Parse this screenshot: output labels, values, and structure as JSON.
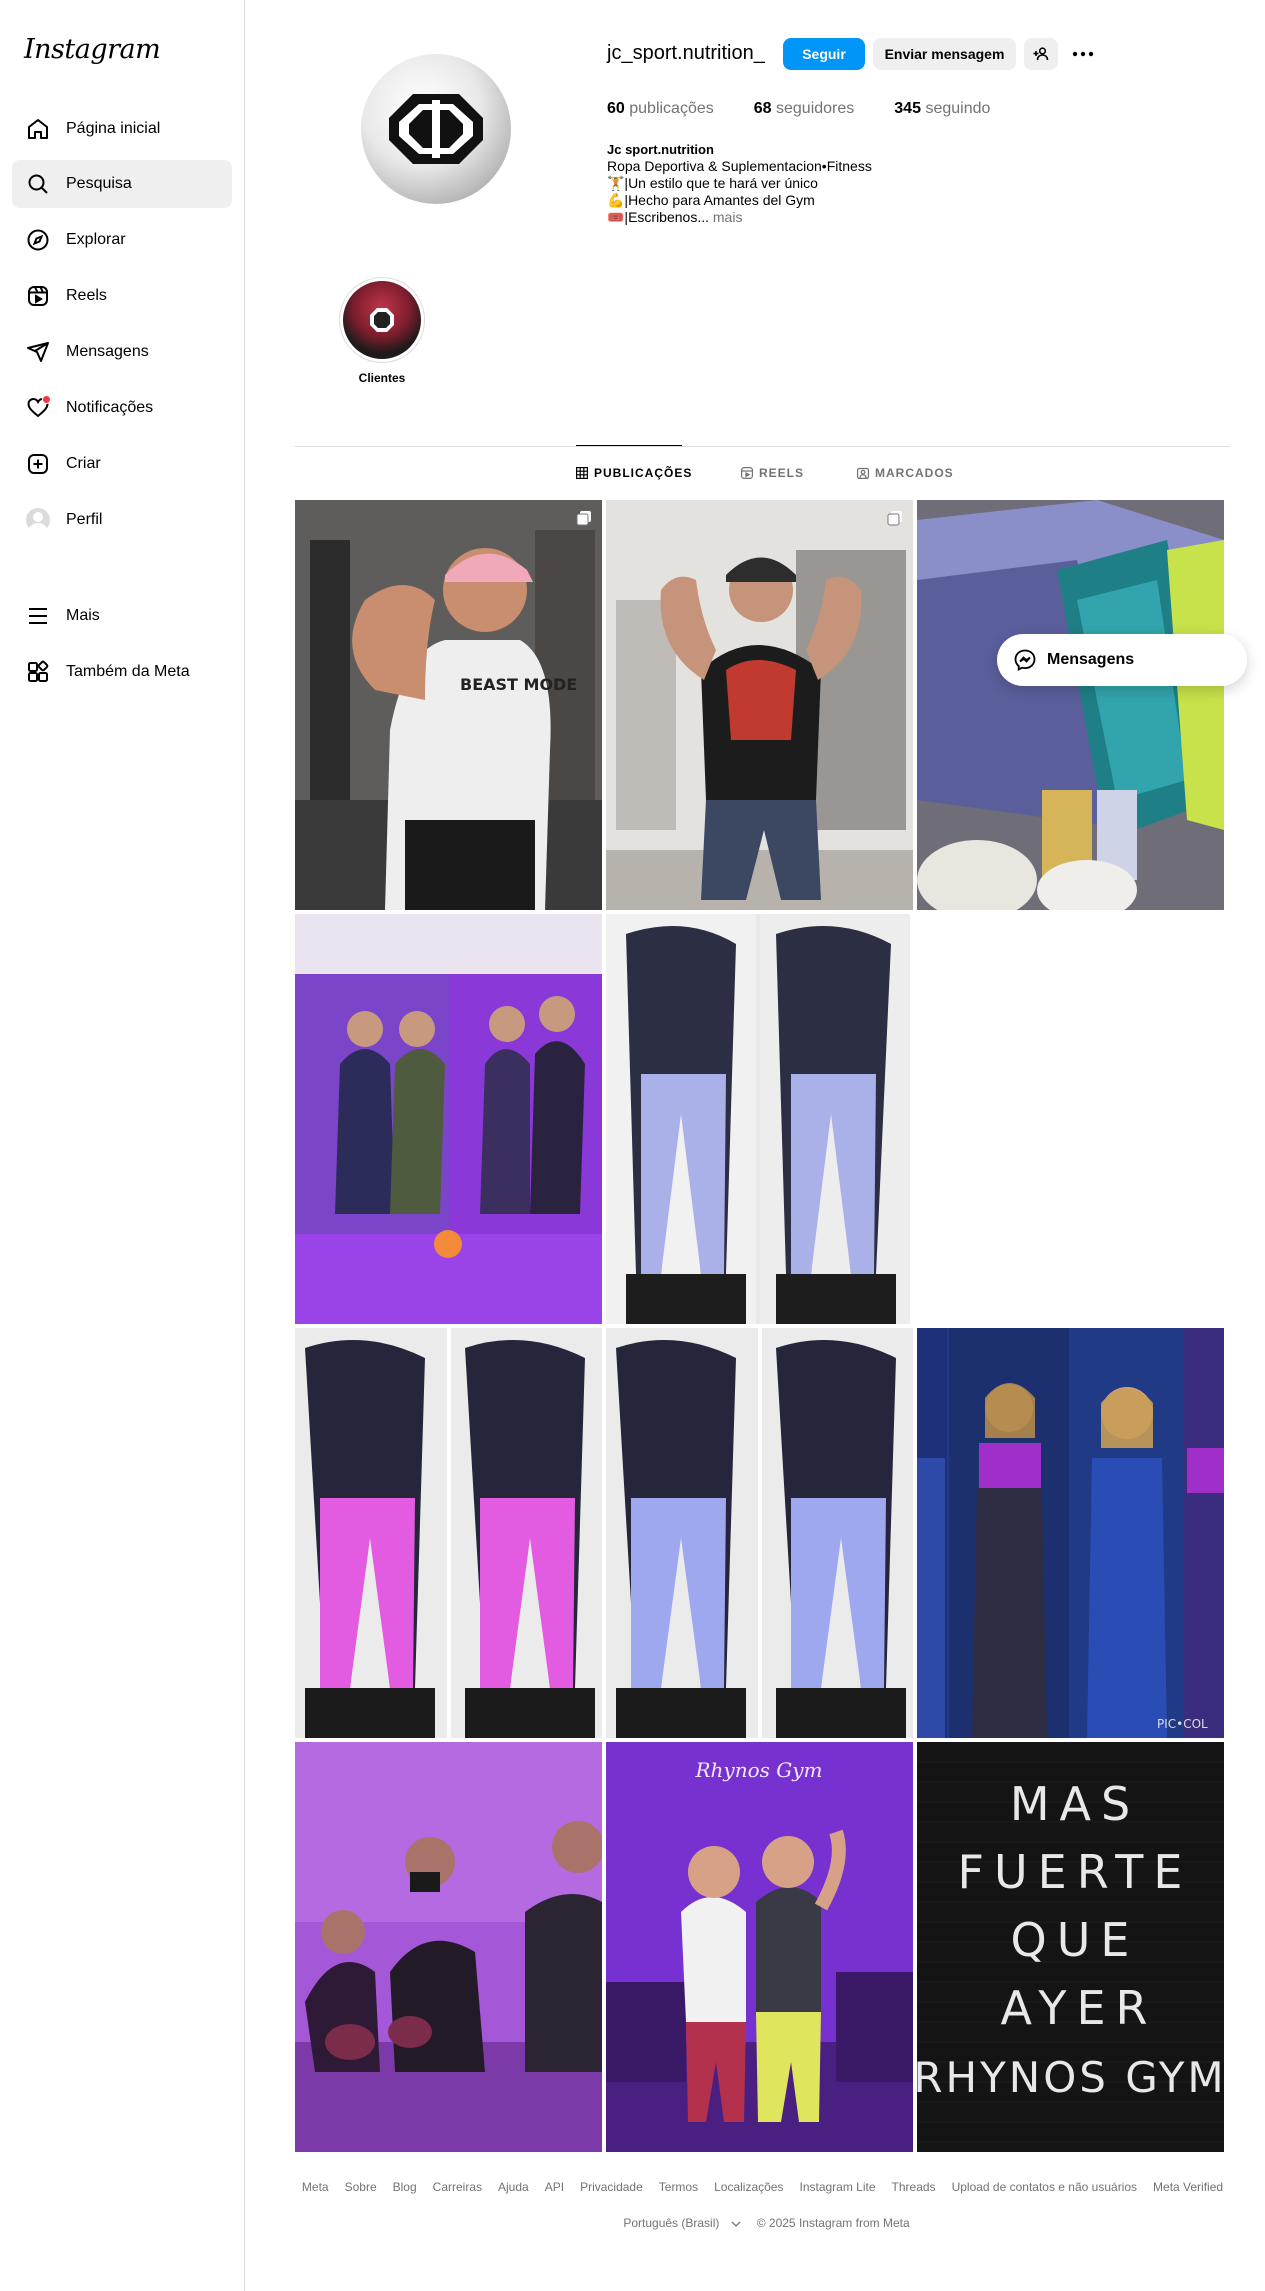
{
  "app": {
    "logo": "Instagram"
  },
  "sidebar": {
    "items": [
      {
        "label": "Página inicial",
        "icon": "home-icon"
      },
      {
        "label": "Pesquisa",
        "icon": "search-icon",
        "active": true
      },
      {
        "label": "Explorar",
        "icon": "compass-icon"
      },
      {
        "label": "Reels",
        "icon": "reels-icon"
      },
      {
        "label": "Mensagens",
        "icon": "messenger-icon"
      },
      {
        "label": "Notificações",
        "icon": "heart-icon",
        "badge": true
      },
      {
        "label": "Criar",
        "icon": "plus-square-icon"
      },
      {
        "label": "Perfil",
        "icon": "avatar"
      },
      {
        "label": "Mais",
        "icon": "menu-icon"
      },
      {
        "label": "Também da Meta",
        "icon": "meta-apps-icon"
      }
    ]
  },
  "profile": {
    "username": "jc_sport.nutrition_",
    "follow_label": "Seguir",
    "message_label": "Enviar mensagem",
    "stats": [
      {
        "count": "60",
        "label": "publicações"
      },
      {
        "count": "68",
        "label": "seguidores"
      },
      {
        "count": "345",
        "label": "seguindo"
      }
    ],
    "bio": {
      "name": "Jc sport.nutrition",
      "lines": [
        "Ropa Deportiva & Suplementacion•Fitness",
        "🏋️|Un estilo que te hará ver único",
        "💪|Hecho para Amantes del Gym",
        "🎟️|Escribenos..."
      ],
      "more": "mais"
    },
    "colors": {
      "accent": "#0095f6",
      "muted": "#737373"
    }
  },
  "highlights": [
    {
      "label": "Clientes"
    }
  ],
  "tabs": [
    {
      "label": "PUBLICAÇÕES",
      "icon": "grid-icon",
      "active": true
    },
    {
      "label": "REELS",
      "icon": "reels-icon"
    },
    {
      "label": "MARCADOS",
      "icon": "tagged-icon"
    }
  ],
  "posts": [
    {
      "name": "post-man-pink-cap",
      "multi": true
    },
    {
      "name": "post-man-red-shirt-gym",
      "multi": true
    },
    {
      "name": "post-leggings-pile",
      "multi": false
    },
    {
      "name": "post-women-purple-gym",
      "multi": false
    },
    {
      "name": "post-tiedye-leggings-lavender-teal",
      "multi": false
    },
    {
      "name": "post-leggings-pink-tiedye",
      "multi": false
    },
    {
      "name": "post-leggings-lavender",
      "multi": false
    },
    {
      "name": "post-women-sports-collage",
      "multi": false,
      "watermark": "PIC•COL"
    },
    {
      "name": "post-group-selfie-gym",
      "multi": false
    },
    {
      "name": "post-two-women-gym-sign",
      "multi": false,
      "sign": "Rhynos Gym"
    },
    {
      "name": "post-letterboard-quote",
      "multi": false,
      "lines": [
        "MAS",
        "FUERTE",
        "QUE",
        "AYER",
        "RHYNOS GYM"
      ]
    }
  ],
  "floating": {
    "label": "Mensagens"
  },
  "footer": {
    "links": [
      "Meta",
      "Sobre",
      "Blog",
      "Carreiras",
      "Ajuda",
      "API",
      "Privacidade",
      "Termos",
      "Localizações",
      "Instagram Lite",
      "Threads",
      "Upload de contatos e não usuários",
      "Meta Verified"
    ],
    "language": "Português (Brasil)",
    "copyright": "© 2025 Instagram from Meta"
  }
}
